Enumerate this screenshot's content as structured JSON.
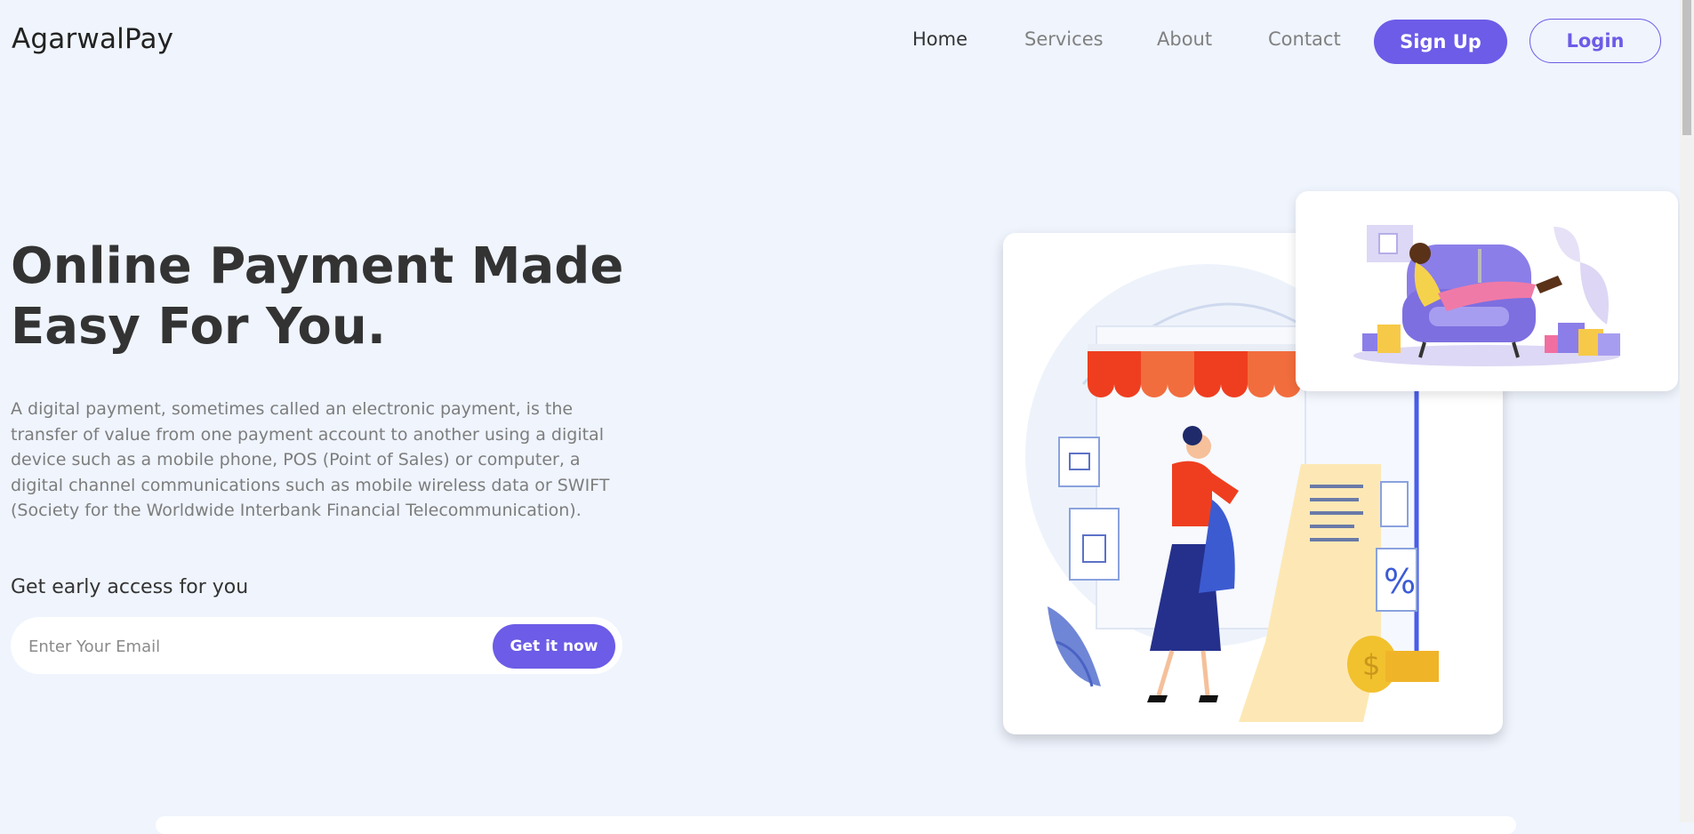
{
  "brand": {
    "name": "AgarwalPay"
  },
  "nav": {
    "links": [
      {
        "label": "Home"
      },
      {
        "label": "Services"
      },
      {
        "label": "About"
      },
      {
        "label": "Contact"
      }
    ],
    "signup_label": "Sign Up",
    "login_label": "Login"
  },
  "hero": {
    "title": "Online Payment Made Easy For You.",
    "description": "A digital payment, sometimes called an electronic payment, is the transfer of value from one payment account to another using a digital device such as a mobile phone, POS (Point of Sales) or computer, a digital channel communications such as mobile wireless data or SWIFT (Society for the Worldwide Interbank Financial Telecommunication).",
    "early_access_label": "Get early access for you",
    "email_placeholder": "Enter Your Email",
    "cta_label": "Get it now"
  },
  "colors": {
    "accent": "#6c5ce7",
    "background": "#eff4fd"
  },
  "illustrations": {
    "main": "online-store-shopping-illustration",
    "secondary": "woman-shopping-on-laptop-illustration"
  }
}
